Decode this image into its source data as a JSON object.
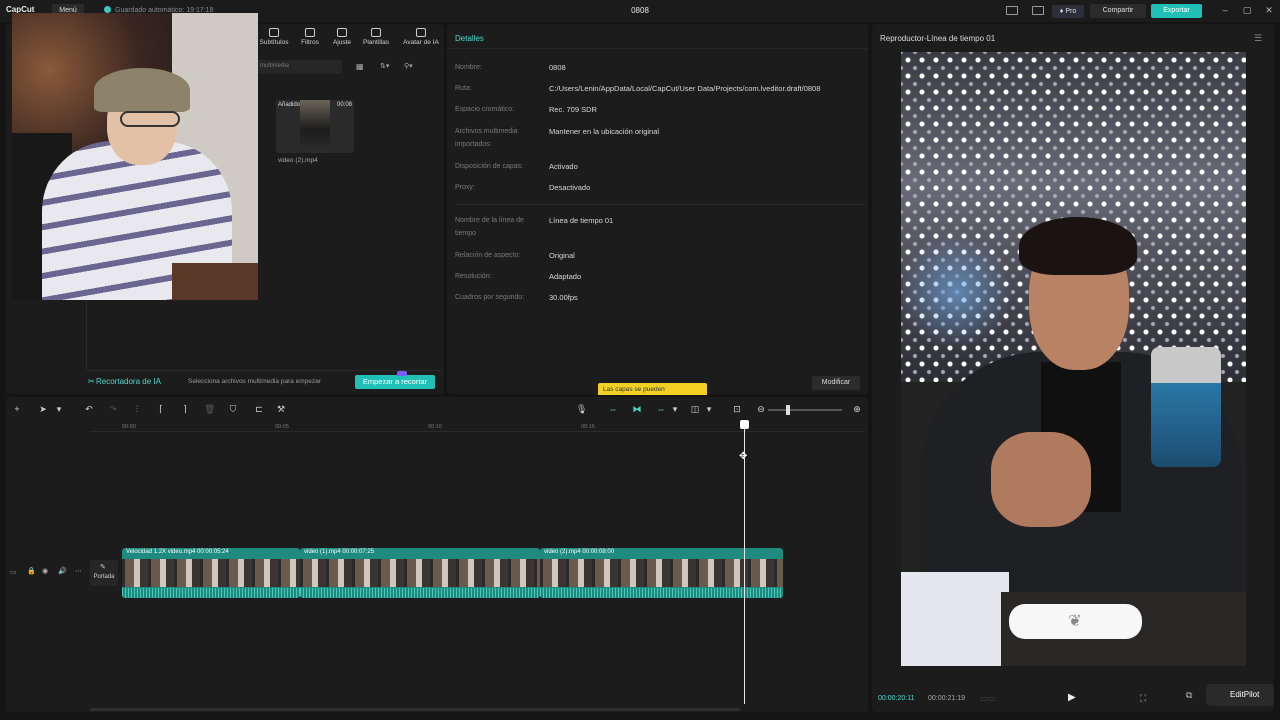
{
  "titlebar": {
    "app_name": "CapCut",
    "menu_label": "Menú",
    "autosave": "Guardado automático: 19:17:18",
    "project_title": "0808",
    "pro_label": "Pro",
    "share_label": "Compartir",
    "export_label": "Exportar"
  },
  "media": {
    "tools": [
      "Subtítulos",
      "Filtros",
      "Ajuste",
      "Plantillas",
      "Avatar de IA"
    ],
    "search_placeholder": "multimedia",
    "thumb_badge": "Añadido",
    "thumb_duration": "00:08",
    "thumb_name": "video (2).mp4",
    "ai_title": "Recortadora de IA",
    "ai_desc": "Selecciona archivos multimedia para empezar",
    "ai_button": "Empezar a recortar"
  },
  "details": {
    "title": "Detalles",
    "rows": [
      {
        "label": "Nombre:",
        "value": "0808"
      },
      {
        "label": "Ruta:",
        "value": "C:/Users/Lenin/AppData/Local/CapCut/User Data/Projects/com.lveditor.draft/0808"
      },
      {
        "label": "Espacio cromático:",
        "value": "Rec. 709 SDR"
      },
      {
        "label": "Archivos multimedia importados:",
        "value": "Mantener en la ubicación original"
      },
      {
        "label": "Disposición de capas:",
        "value": "Activado"
      },
      {
        "label": "Proxy:",
        "value": "Desactivado"
      },
      {
        "label": "Nombre de la línea de tiempo",
        "value": "Línea de tiempo 01"
      },
      {
        "label": "Relación de aspecto:",
        "value": "Original"
      },
      {
        "label": "Resolución:",
        "value": "Adaptado"
      },
      {
        "label": "Cuadros por segundo:",
        "value": "30.00fps"
      }
    ],
    "toast": "Las capas se pueden",
    "modify_button": "Modificar"
  },
  "player": {
    "title": "Reproductor-Línea de tiempo 01",
    "time_current": "00:00:20:11",
    "time_total": "00:00:21:19",
    "editpilot": "EditPilot"
  },
  "timeline": {
    "ruler": [
      "00:00",
      "00:05",
      "00:10",
      "00:15"
    ],
    "cover_label": "Portada",
    "clips": [
      {
        "label": "Velocidad 1.2X  video.mp4  00:00:05:24"
      },
      {
        "label": "video (1).mp4  00:00:07:25"
      },
      {
        "label": "video (2).mp4  00:00:08:00"
      }
    ]
  },
  "colors": {
    "accent": "#20c0b6",
    "accent_text": "#4ed8cf",
    "toast": "#f2d024"
  }
}
